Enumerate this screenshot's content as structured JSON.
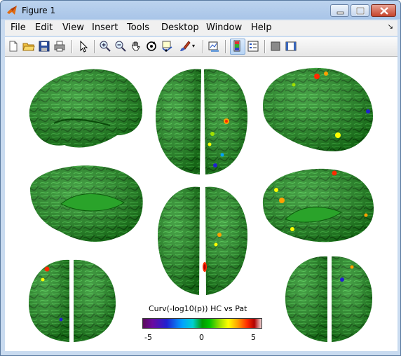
{
  "window": {
    "title": "Figure 1"
  },
  "menu": [
    "File",
    "Edit",
    "View",
    "Insert",
    "Tools",
    "Desktop",
    "Window",
    "Help"
  ],
  "toolbar": {
    "icons": [
      "new-figure-icon",
      "open-file-icon",
      "save-icon",
      "print-icon",
      "arrow-pointer-icon",
      "zoom-in-icon",
      "zoom-out-icon",
      "pan-hand-icon",
      "rotate-3d-icon",
      "data-cursor-icon",
      "brush-icon",
      "brush-dropdown-icon",
      "link-plot-icon",
      "colorbar-icon",
      "legend-icon",
      "hide-plot-tools-icon",
      "show-plot-tools-icon"
    ]
  },
  "colorbar": {
    "title": "Curv(-log10(p))  HC vs Pat",
    "ticks": [
      "-5",
      "0",
      "5"
    ],
    "colors": [
      "#5a0b5a",
      "#2020d0",
      "#00a0ff",
      "#009a00",
      "#a0e000",
      "#ffff00",
      "#ff2a00",
      "#b00000"
    ]
  },
  "brains": {
    "base_color": "#1e8c1e",
    "highlight_color": "#3fc23f"
  }
}
